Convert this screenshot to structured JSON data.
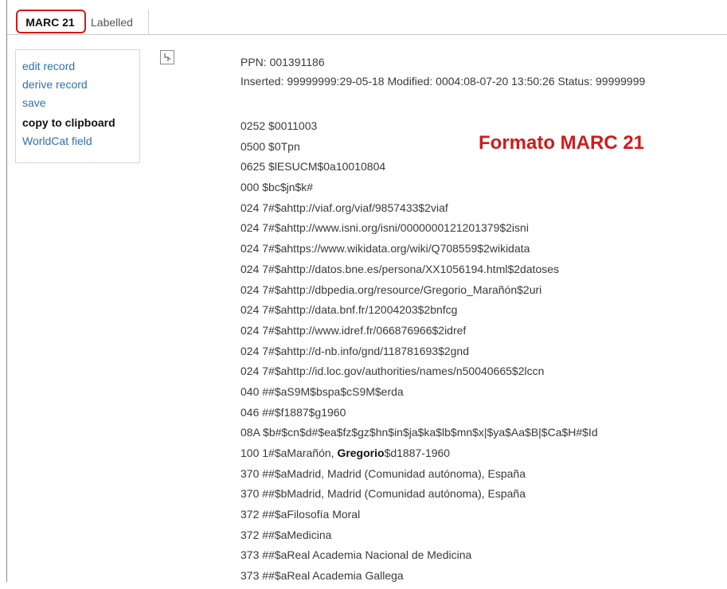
{
  "tabs": [
    {
      "label": "MARC 21",
      "active": true
    },
    {
      "label": "Labelled",
      "active": false
    }
  ],
  "actions": {
    "edit": "edit record",
    "derive": "derive record",
    "save": "save",
    "copy": "copy to clipboard",
    "worldcat": "WorldCat field"
  },
  "record": {
    "ppn": "PPN: 001391186",
    "status_line": "Inserted: 99999999:29-05-18 Modified: 0004:08-07-20 13:50:26 Status: 99999999",
    "fields": [
      "0252 $0011003",
      "0500 $0Tpn",
      "0625 $lESUCM$0a10010804",
      "000 $bc$jn$k#",
      "024 7#$ahttp://viaf.org/viaf/9857433$2viaf",
      "024 7#$ahttp://www.isni.org/isni/0000000121201379$2isni",
      "024 7#$ahttps://www.wikidata.org/wiki/Q708559$2wikidata",
      "024 7#$ahttp://datos.bne.es/persona/XX1056194.html$2datoses",
      "024 7#$ahttp://dbpedia.org/resource/Gregorio_Marañón$2uri",
      "024 7#$ahttp://data.bnf.fr/12004203$2bnfcg",
      "024 7#$ahttp://www.idref.fr/066876966$2idref",
      "024 7#$ahttp://d-nb.info/gnd/118781693$2gnd",
      "024 7#$ahttp://id.loc.gov/authorities/names/n50040665$2lccn",
      "040 ##$aS9M$bspa$cS9M$erda",
      "046 ##$f1887$g1960",
      "08A $b#$cn$d#$ea$fz$gz$hn$in$ja$ka$lb$mn$x|$ya$Aa$B|$Ca$H#$Id",
      "100 1#$aMarañón, ",
      "370 ##$aMadrid, Madrid (Comunidad autónoma), España",
      "370 ##$bMadrid, Madrid (Comunidad autónoma), España",
      "372 ##$aFilosofía Moral",
      "372 ##$aMedicina",
      "373 ##$aReal Academia Nacional de Medicina",
      "373 ##$aReal Academia Gallega"
    ],
    "field_100_bold": "Gregorio",
    "field_100_tail": "$d1887-1960"
  },
  "annotation": "Formato MARC 21",
  "colors": {
    "annotation": "#d01b1b",
    "link": "#2f6fb0",
    "tab_highlight": "#d11a1a"
  },
  "icons": {
    "record_icon": "pin-icon"
  }
}
